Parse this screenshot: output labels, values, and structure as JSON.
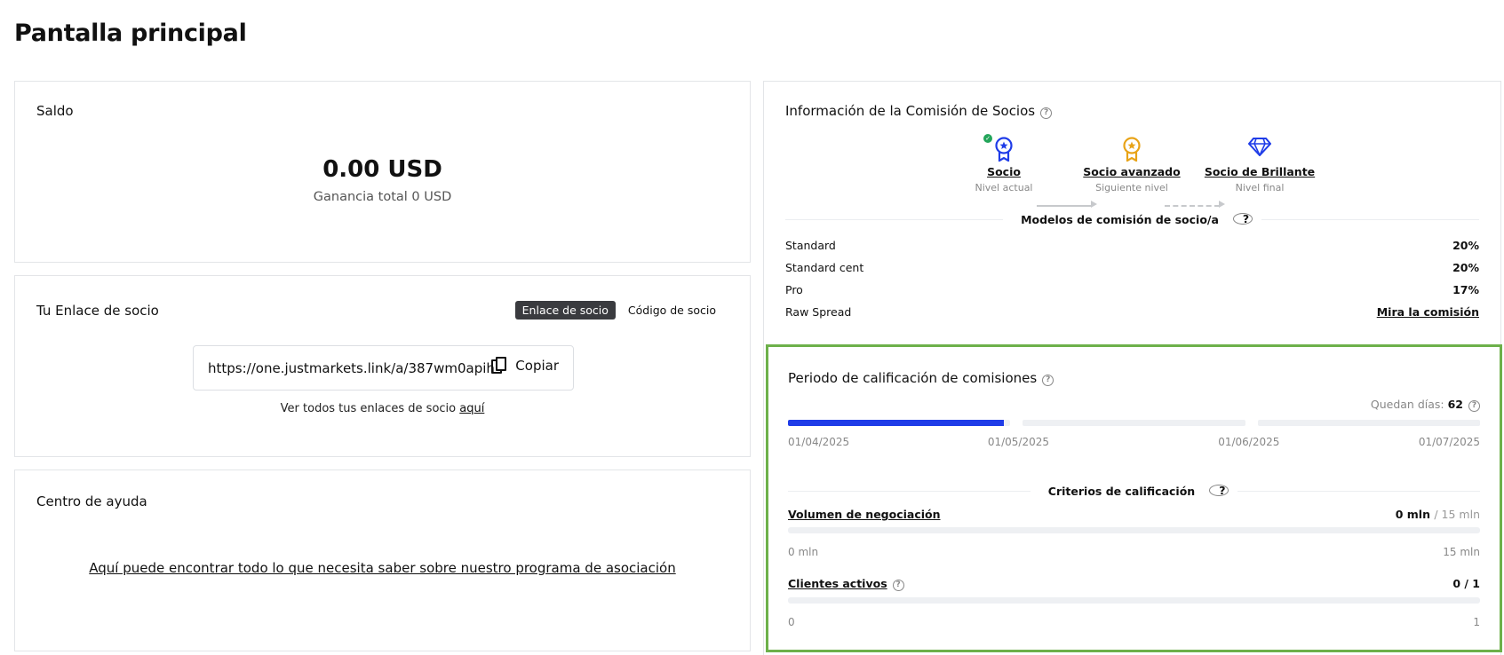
{
  "page": {
    "title": "Pantalla principal"
  },
  "balance": {
    "title": "Saldo",
    "amount": "0.00 USD",
    "total_label": "Ganancia total 0 USD"
  },
  "partner_link": {
    "title": "Tu Enlace de socio",
    "tabs": [
      {
        "label": "Enlace de socio",
        "active": true
      },
      {
        "label": "Código de socio",
        "active": false
      }
    ],
    "url": "https://one.justmarkets.link/a/387wm0apih",
    "copy_label": "Copiar",
    "see_all_text": "Ver todos tus enlaces de socio",
    "see_all_link": "aquí"
  },
  "help_center": {
    "title": "Centro de ayuda",
    "link_text": "Aquí puede encontrar todo lo que necesita saber sobre nuestro programa de asociación"
  },
  "commission": {
    "title": "Información de la Comisión de Socios",
    "help_glyph": "?",
    "levels": [
      {
        "name": "Socio",
        "sub": "Nivel actual",
        "icon": "medal-icon",
        "color": "#1f3ce8"
      },
      {
        "name": "Socio avanzado",
        "sub": "Siguiente nivel",
        "icon": "medal-icon",
        "color": "#e8a317"
      },
      {
        "name": "Socio de Brillante",
        "sub": "Nivel final",
        "icon": "diamond-icon",
        "color": "#1f3ce8"
      }
    ],
    "models_title": "Modelos de comisión de socio/a",
    "models": [
      {
        "name": "Standard",
        "value": "20%"
      },
      {
        "name": "Standard cent",
        "value": "20%"
      },
      {
        "name": "Pro",
        "value": "17%"
      },
      {
        "name": "Raw Spread",
        "value": "Mira la comisión"
      }
    ]
  },
  "qualification": {
    "title": "Periodo de calificación de comisiones",
    "days_label": "Quedan días:",
    "days_value": "62",
    "timeline_progress": [
      1.0,
      0.0,
      0.0
    ],
    "timeline_first_fill": 0.97,
    "dates": [
      "01/04/2025",
      "01/05/2025",
      "01/06/2025",
      "01/07/2025"
    ],
    "criteria_title": "Criterios de calificación",
    "criteria": [
      {
        "label": "Volumen de negociación",
        "current": "0 mln",
        "target": "/ 15 mln",
        "progress": 0,
        "min": "0 mln",
        "max": "15 mln",
        "help": false
      },
      {
        "label": "Clientes activos",
        "current": "0 / 1",
        "target": "",
        "progress": 0,
        "min": "0",
        "max": "1",
        "help": true
      }
    ]
  },
  "colors": {
    "accent": "#1f3ce8",
    "gold": "#e8a317",
    "success": "#23a55a",
    "highlight": "#6db04a"
  }
}
